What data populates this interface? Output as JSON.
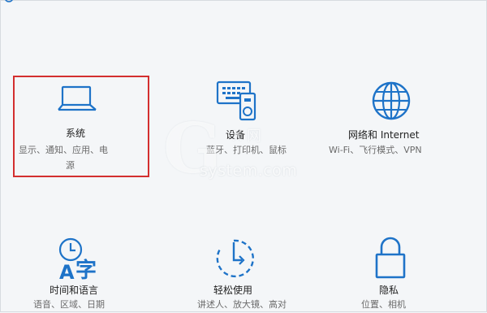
{
  "accent_color": "#1e73c8",
  "tiles": [
    {
      "title": "系统",
      "desc_line1": "显示、通知、应用、电",
      "desc_line2": "源",
      "icon": "laptop-icon",
      "selected": true
    },
    {
      "title": "设备",
      "desc_line1": "蓝牙、打印机、鼠标",
      "icon": "devices-icon"
    },
    {
      "title": "网络和 Internet",
      "desc_line1": "Wi-Fi、飞行模式、VPN",
      "icon": "globe-icon"
    },
    {
      "title": "时间和语言",
      "desc_line1": "语音、区域、日期",
      "icon": "time-language-icon"
    },
    {
      "title": "轻松使用",
      "desc_line1": "讲述人、放大镜、高对",
      "icon": "ease-of-access-icon"
    },
    {
      "title": "隐私",
      "desc_line1": "位置、相机",
      "icon": "lock-icon"
    }
  ],
  "watermark": {
    "letter": "G",
    "text": "system.com",
    "sub": "X 网"
  }
}
